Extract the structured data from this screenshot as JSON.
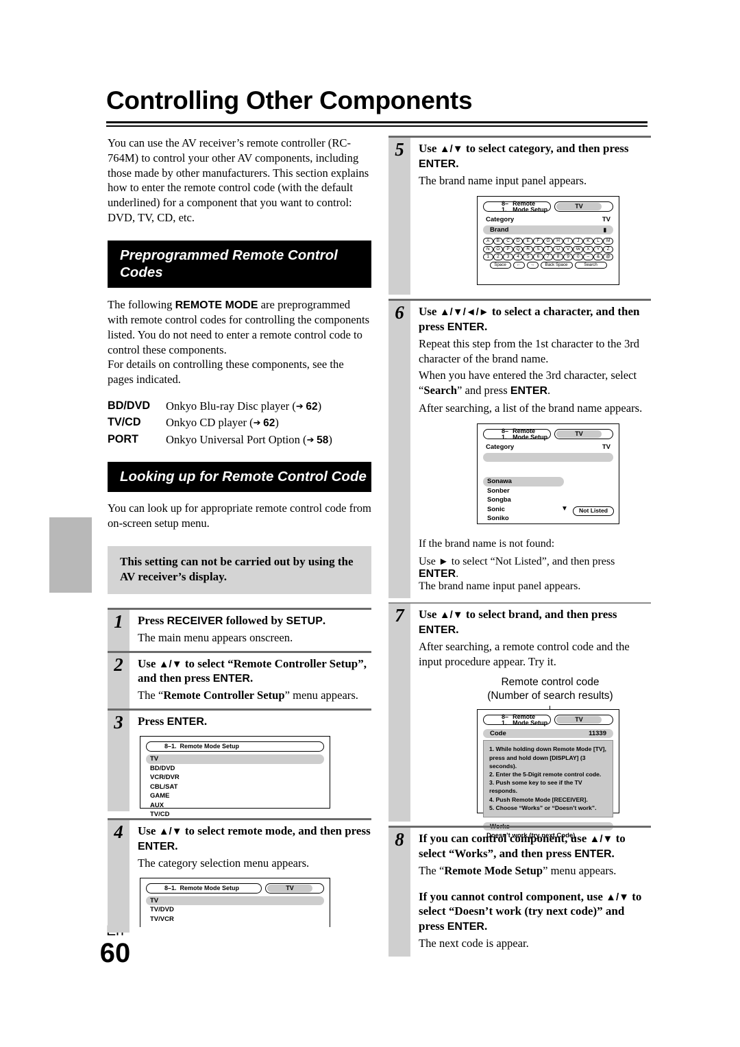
{
  "doc": {
    "title": "Controlling Other Components",
    "footer_lang": "En",
    "footer_page": "60"
  },
  "intro": {
    "paragraph": "You can use the AV receiver’s remote controller (RC-764M) to control your other AV components, including those made by other manufacturers. This section explains how to enter the remote control code (with the default underlined) for a component that you want to control: DVD, TV, CD, etc."
  },
  "section_preprogrammed": {
    "heading": "Preprogrammed Remote Control Codes",
    "para1": "The following ",
    "para1_bold": "REMOTE MODE",
    "para1_rest": " are preprogrammed with remote control codes for controlling the components listed. You do not need to enter a remote control code to control these components.",
    "para2": "For details on controlling these components, see the pages indicated.",
    "modes": [
      {
        "key": "BD/DVD",
        "desc": "Onkyo Blu-ray Disc player (",
        "page": "62",
        "close": ")"
      },
      {
        "key": "TV/CD",
        "desc": "Onkyo CD player (",
        "page": "62",
        "close": ")"
      },
      {
        "key": "PORT",
        "desc": "Onkyo Universal Port Option (",
        "page": "58",
        "close": ")"
      }
    ]
  },
  "section_lookup": {
    "heading": "Looking up for Remote Control Code",
    "para": "You can look up for appropriate remote control code from on-screen setup menu.",
    "note": "This setting can not be carried out by using the AV receiver’s display."
  },
  "steps": {
    "s1": {
      "num": "1",
      "head_a": "Press ",
      "head_b": "RECEIVER",
      "head_c": " followed by ",
      "head_d": "SETUP",
      "head_e": ".",
      "sub": "The main menu appears onscreen."
    },
    "s2": {
      "num": "2",
      "head_a": "Use ",
      "head_arrows": "▲/▼",
      "head_b": " to select “Remote Controller Setup”, and then press ",
      "head_c": "ENTER",
      "head_d": ".",
      "sub_a": "The “",
      "sub_b": "Remote Controller Setup",
      "sub_c": "” menu appears."
    },
    "s3": {
      "num": "3",
      "head_a": "Press ",
      "head_b": "ENTER",
      "head_c": "."
    },
    "s4": {
      "num": "4",
      "head_a": "Use ",
      "head_arrows": "▲/▼",
      "head_b": " to select remote mode, and then press ",
      "head_c": "ENTER",
      "head_d": ".",
      "sub": "The category selection menu appears."
    },
    "s5": {
      "num": "5",
      "head_a": "Use ",
      "head_arrows": "▲/▼",
      "head_b": " to select category, and then press ",
      "head_c": "ENTER",
      "head_d": ".",
      "sub": "The brand name input panel appears."
    },
    "s6": {
      "num": "6",
      "head_a": "Use ",
      "head_arrows": "▲/▼/◄/►",
      "head_b": " to select a character, and then press ",
      "head_c": "ENTER",
      "head_d": ".",
      "sub1": "Repeat this step from the 1st character to the 3rd character of the brand name.",
      "sub2_a": "When you have entered the 3rd character, select “",
      "sub2_b": "Search",
      "sub2_c": "” and press ",
      "sub2_d": "ENTER",
      "sub2_e": ".",
      "sub3": "After searching, a list of the brand name appears."
    },
    "s_notfound": {
      "head1": "If the brand name is not found:",
      "head2_a": "Use ",
      "head2_arrow": "►",
      "head2_b": " to select “Not Listed”, and then press ",
      "head2_c": "ENTER",
      "head2_d": ".",
      "sub": "The brand name input panel appears."
    },
    "s7": {
      "num": "7",
      "head_a": "Use ",
      "head_arrows": "▲/▼",
      "head_b": " to select brand, and then press ",
      "head_c": "ENTER",
      "head_d": ".",
      "sub": "After searching, a remote control code and the input procedure appear. Try it."
    },
    "s8": {
      "num": "8",
      "head_a": "If you can control component, use ",
      "head_arrows": "▲/▼",
      "head_b": " to select “Works”, and then press ",
      "head_c": "ENTER",
      "head_d": ".",
      "sub_a": "The “",
      "sub_b": "Remote Mode Setup",
      "sub_c": "” menu appears.",
      "head2_a": "If you cannot control component, use ",
      "head2_arrows": "▲/▼",
      "head2_b": " to select “Doesn’t work (try next code)” and press ",
      "head2_c": "ENTER",
      "head2_d": ".",
      "sub2": "The next code is appear."
    }
  },
  "osd": {
    "menu_number": "8–1.",
    "menu_name": "Remote Mode Setup",
    "tv_tag": "TV",
    "remote_mode_list": [
      "TV",
      "BD/DVD",
      "VCR/DVR",
      "CBL/SAT",
      "GAME",
      "AUX",
      "TV/CD"
    ],
    "category_list": [
      "TV",
      "TV/DVD",
      "TV/VCR"
    ],
    "brand_panel": {
      "category_label": "Category",
      "category_value": "TV",
      "brand_label": "Brand",
      "cursor": "▮",
      "keyboard_row1": [
        "A",
        "B",
        "C",
        "D",
        "E",
        "F",
        "G",
        "H",
        "I",
        "J",
        "K",
        "L",
        "M"
      ],
      "keyboard_row2": [
        "N",
        "O",
        "P",
        "Q",
        "R",
        "S",
        "T",
        "U",
        "V",
        "W",
        "X",
        "Y",
        "Z"
      ],
      "keyboard_row3": [
        "1",
        "2",
        "3",
        "4",
        "5",
        "6",
        "7",
        "8",
        "9",
        "0",
        "–",
        "&",
        "@"
      ],
      "keyboard_bottom": [
        "Space",
        "←",
        "→",
        "Back Space",
        "Search"
      ]
    },
    "brand_results": {
      "category_label": "Category",
      "category_value": "TV",
      "brands": [
        "Sonawa",
        "Sonber",
        "Songba",
        "Sonic",
        "Soniko"
      ],
      "down_arrow": "▼",
      "not_listed": "Not Listed"
    },
    "code_panel": {
      "caption_line1": "Remote control code",
      "caption_line2": "(Number of search results)",
      "code_label": "Code",
      "code_value": "11339",
      "instructions": [
        "1.  While holding down Remote Mode [TV],",
        "press and hold down [DISPLAY] (3 seconds).",
        "2.  Enter the 5-Digit remote control code.",
        "3.  Push some key to see if the TV responds.",
        "4.  Push Remote Mode [RECEIVER].",
        "5.  Choose “Works” or “Doesn’t work”."
      ],
      "works": "Works",
      "doesnt_work": "Doesn’t work (try next Code)"
    }
  }
}
